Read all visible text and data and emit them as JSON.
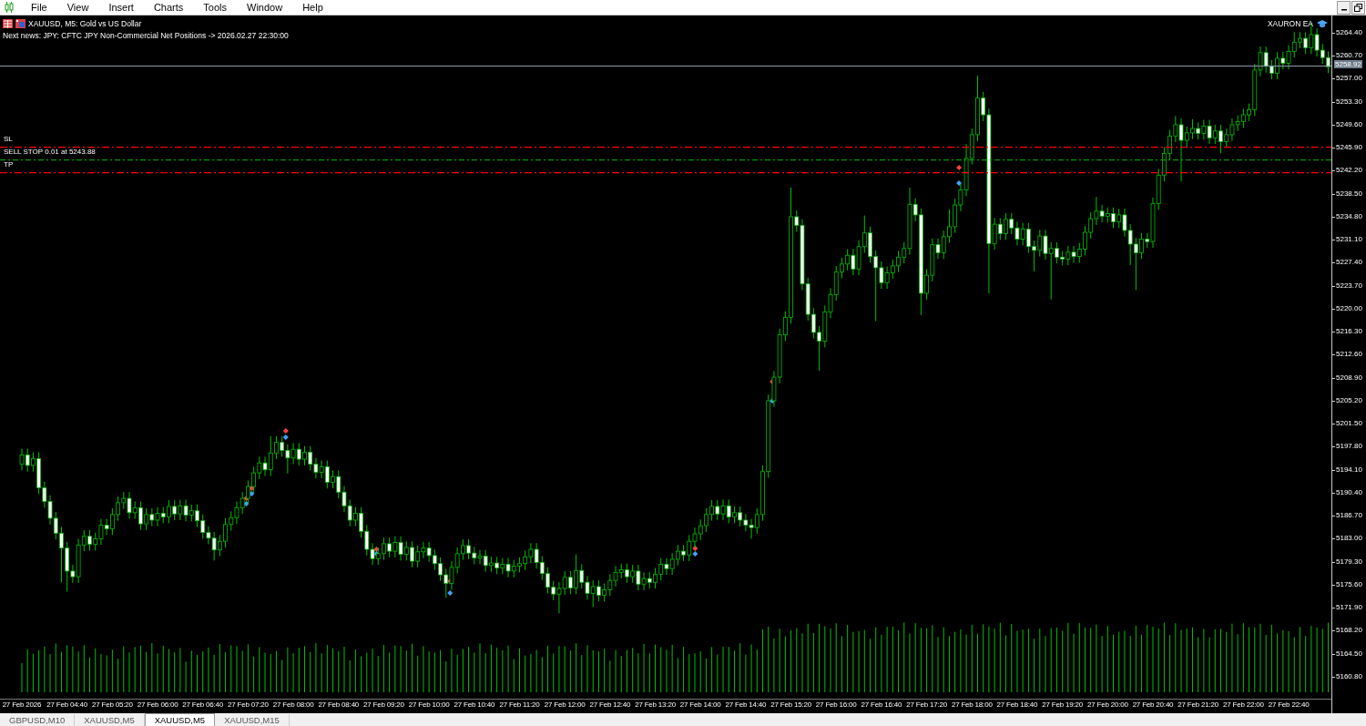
{
  "menu": [
    {
      "label": "File"
    },
    {
      "label": "View"
    },
    {
      "label": "Insert"
    },
    {
      "label": "Charts"
    },
    {
      "label": "Tools"
    },
    {
      "label": "Window"
    },
    {
      "label": "Help"
    }
  ],
  "chart": {
    "title": "XAUUSD, M5:  Gold vs US Dollar",
    "news": "Next news: JPY: CFTC JPY Non-Commercial Net Positions -> 2026.02.27 22:30:00",
    "expert": "XAURON EA",
    "orders": [
      {
        "kind": "stop_loss",
        "label": "SL",
        "color": "#ff0000"
      },
      {
        "kind": "pending",
        "label": "SELL STOP 0.01 at 5243.88",
        "color": "#00a000"
      },
      {
        "kind": "take_profit",
        "label": "TP",
        "color": "#ff0000"
      }
    ],
    "bid": "5258.92",
    "chart_data": {
      "type": "candlestick",
      "categories": [
        "27 Feb 2026",
        null,
        null,
        null,
        null,
        null,
        null,
        null,
        "27 Feb 04:40",
        null,
        null,
        null,
        null,
        null,
        null,
        null,
        "27 Feb 05:20",
        null,
        null,
        null,
        null,
        null,
        null,
        null,
        "27 Feb 06:00",
        null,
        null,
        null,
        null,
        null,
        null,
        null,
        "27 Feb 06:40",
        null,
        null,
        null,
        null,
        null,
        null,
        null,
        "27 Feb 07:20",
        null,
        null,
        null,
        null,
        null,
        null,
        null,
        "27 Feb 08:00",
        null,
        null,
        null,
        null,
        null,
        null,
        null,
        "27 Feb 08:40",
        null,
        null,
        null,
        null,
        null,
        null,
        null,
        "27 Feb 09:20",
        null,
        null,
        null,
        null,
        null,
        null,
        null,
        "27 Feb 10:00",
        null,
        null,
        null,
        null,
        null,
        null,
        null,
        "27 Feb 10:40",
        null,
        null,
        null,
        null,
        null,
        null,
        null,
        "27 Feb 11:20",
        null,
        null,
        null,
        null,
        null,
        null,
        null,
        "27 Feb 12:00",
        null,
        null,
        null,
        null,
        null,
        null,
        null,
        "27 Feb 12:40",
        null,
        null,
        null,
        null,
        null,
        null,
        null,
        "27 Feb 13:20",
        null,
        null,
        null,
        null,
        null,
        null,
        null,
        "27 Feb 14:00",
        null,
        null,
        null,
        null,
        null,
        null,
        null,
        "27 Feb 14:40",
        null,
        null,
        null,
        null,
        null,
        null,
        null,
        "27 Feb 15:20",
        null,
        null,
        null,
        null,
        null,
        null,
        null,
        "27 Feb 16:00",
        null,
        null,
        null,
        null,
        null,
        null,
        null,
        "27 Feb 16:40",
        null,
        null,
        null,
        null,
        null,
        null,
        null,
        "27 Feb 17:20",
        null,
        null,
        null,
        null,
        null,
        null,
        null,
        "27 Feb 18:00",
        null,
        null,
        null,
        null,
        null,
        null,
        null,
        "27 Feb 18:40",
        null,
        null,
        null,
        null,
        null,
        null,
        null,
        "27 Feb 19:20",
        null,
        null,
        null,
        null,
        null,
        null,
        null,
        "27 Feb 20:00",
        null,
        null,
        null,
        null,
        null,
        null,
        null,
        "27 Feb 20:40",
        null,
        null,
        null,
        null,
        null,
        null,
        null,
        "27 Feb 21:20",
        null,
        null,
        null,
        null,
        null,
        null,
        null,
        "27 Feb 22:00",
        null,
        null,
        null,
        null,
        null,
        null,
        null,
        "27 Feb 22:40",
        null,
        null,
        null,
        null,
        null,
        null,
        null
      ],
      "ohlc": [
        [
          5195.0,
          5197.5,
          5194.0,
          5196.5
        ],
        [
          5196.5,
          5197.5,
          5193.8,
          5194.8
        ],
        [
          5194.8,
          5196.9,
          5193.8,
          5195.9
        ],
        [
          5195.9,
          5196.9,
          5190.2,
          5191.2
        ],
        [
          5191.2,
          5192.2,
          5188.0,
          5189.0
        ],
        [
          5189.0,
          5190.0,
          5185.3,
          5186.3
        ],
        [
          5186.3,
          5187.3,
          5182.9,
          5183.9
        ],
        [
          5183.9,
          5184.9,
          5176.0,
          5181.5
        ],
        [
          5181.5,
          5182.5,
          5174.5,
          5177.8
        ],
        [
          5177.8,
          5178.8,
          5175.9,
          5176.9
        ],
        [
          5176.9,
          5183.0,
          5175.9,
          5182.0
        ],
        [
          5182.0,
          5184.4,
          5181.0,
          5183.4
        ],
        [
          5183.4,
          5184.4,
          5181.1,
          5182.1
        ],
        [
          5182.1,
          5184.0,
          5181.1,
          5183.0
        ],
        [
          5183.0,
          5186.2,
          5182.0,
          5185.2
        ],
        [
          5185.2,
          5186.2,
          5183.6,
          5184.6
        ],
        [
          5184.6,
          5187.9,
          5183.6,
          5186.9
        ],
        [
          5186.9,
          5189.8,
          5185.9,
          5188.8
        ],
        [
          5188.8,
          5190.5,
          5187.8,
          5189.5
        ],
        [
          5189.5,
          5190.5,
          5186.2,
          5187.2
        ],
        [
          5187.2,
          5189.0,
          5186.2,
          5188.0
        ],
        [
          5188.0,
          5189.0,
          5184.4,
          5185.4
        ],
        [
          5185.4,
          5187.9,
          5184.4,
          5186.9
        ],
        [
          5186.9,
          5187.9,
          5185.0,
          5186.0
        ],
        [
          5186.0,
          5188.1,
          5185.0,
          5187.1
        ],
        [
          5187.1,
          5188.1,
          5185.5,
          5186.5
        ],
        [
          5186.5,
          5189.2,
          5185.5,
          5188.2
        ],
        [
          5188.2,
          5189.2,
          5186.0,
          5187.0
        ],
        [
          5187.0,
          5189.3,
          5186.0,
          5188.3
        ],
        [
          5188.3,
          5189.3,
          5185.8,
          5186.8
        ],
        [
          5186.8,
          5188.5,
          5185.8,
          5187.5
        ],
        [
          5187.5,
          5188.5,
          5184.9,
          5185.9
        ],
        [
          5185.9,
          5186.9,
          5183.0,
          5184.0
        ],
        [
          5184.0,
          5185.0,
          5182.1,
          5183.1
        ],
        [
          5183.1,
          5184.1,
          5179.5,
          5181.2
        ],
        [
          5181.2,
          5183.6,
          5180.2,
          5182.6
        ],
        [
          5182.6,
          5186.3,
          5181.6,
          5185.3
        ],
        [
          5185.3,
          5187.4,
          5184.3,
          5186.4
        ],
        [
          5186.4,
          5189.0,
          5185.4,
          5188.0
        ],
        [
          5188.0,
          5190.5,
          5187.0,
          5189.5
        ],
        [
          5189.5,
          5192.4,
          5188.5,
          5191.4
        ],
        [
          5191.4,
          5194.6,
          5190.4,
          5193.6
        ],
        [
          5193.6,
          5196.2,
          5192.6,
          5195.2
        ],
        [
          5195.2,
          5196.2,
          5193.1,
          5194.1
        ],
        [
          5194.1,
          5199.5,
          5193.1,
          5196.8
        ],
        [
          5196.8,
          5199.5,
          5195.8,
          5198.5
        ],
        [
          5198.5,
          5199.5,
          5196.2,
          5197.2
        ],
        [
          5197.2,
          5198.2,
          5193.5,
          5196.0
        ],
        [
          5196.0,
          5198.4,
          5195.0,
          5197.4
        ],
        [
          5197.4,
          5198.4,
          5194.8,
          5195.8
        ],
        [
          5195.8,
          5197.9,
          5194.8,
          5196.9
        ],
        [
          5196.9,
          5197.9,
          5194.0,
          5195.0
        ],
        [
          5195.0,
          5196.0,
          5192.7,
          5193.7
        ],
        [
          5193.7,
          5195.6,
          5192.7,
          5194.6
        ],
        [
          5194.6,
          5195.6,
          5191.1,
          5192.1
        ],
        [
          5192.1,
          5194.0,
          5191.1,
          5193.0
        ],
        [
          5193.0,
          5194.0,
          5189.5,
          5190.5
        ],
        [
          5190.5,
          5191.5,
          5187.3,
          5188.3
        ],
        [
          5188.3,
          5189.3,
          5185.0,
          5186.0
        ],
        [
          5186.0,
          5188.1,
          5185.0,
          5187.1
        ],
        [
          5187.1,
          5188.1,
          5183.2,
          5184.2
        ],
        [
          5184.2,
          5185.2,
          5180.3,
          5181.3
        ],
        [
          5181.3,
          5182.3,
          5178.8,
          5179.8
        ],
        [
          5179.8,
          5181.6,
          5178.8,
          5180.6
        ],
        [
          5180.6,
          5183.2,
          5179.6,
          5182.2
        ],
        [
          5182.2,
          5183.2,
          5180.0,
          5181.0
        ],
        [
          5181.0,
          5183.4,
          5180.0,
          5182.4
        ],
        [
          5182.4,
          5183.4,
          5179.5,
          5180.5
        ],
        [
          5180.5,
          5182.6,
          5179.5,
          5181.6
        ],
        [
          5181.6,
          5182.6,
          5178.4,
          5179.4
        ],
        [
          5179.4,
          5181.9,
          5178.4,
          5180.9
        ],
        [
          5180.9,
          5182.5,
          5179.9,
          5181.5
        ],
        [
          5181.5,
          5182.5,
          5179.3,
          5180.3
        ],
        [
          5180.3,
          5181.3,
          5178.0,
          5179.0
        ],
        [
          5179.0,
          5180.0,
          5176.2,
          5177.2
        ],
        [
          5177.2,
          5178.2,
          5173.5,
          5175.8
        ],
        [
          5175.8,
          5179.4,
          5174.8,
          5178.4
        ],
        [
          5178.4,
          5181.6,
          5177.4,
          5180.6
        ],
        [
          5180.6,
          5182.9,
          5179.6,
          5181.9
        ],
        [
          5181.9,
          5182.9,
          5179.7,
          5180.7
        ],
        [
          5180.7,
          5181.7,
          5178.9,
          5179.9
        ],
        [
          5179.9,
          5181.2,
          5178.9,
          5180.2
        ],
        [
          5180.2,
          5181.2,
          5177.7,
          5178.7
        ],
        [
          5178.7,
          5180.1,
          5177.7,
          5179.1
        ],
        [
          5179.1,
          5180.1,
          5177.3,
          5178.3
        ],
        [
          5178.3,
          5179.9,
          5177.3,
          5178.9
        ],
        [
          5178.9,
          5179.9,
          5176.8,
          5177.8
        ],
        [
          5177.8,
          5179.6,
          5176.8,
          5178.6
        ],
        [
          5178.6,
          5180.0,
          5177.6,
          5179.0
        ],
        [
          5179.0,
          5181.1,
          5178.0,
          5180.1
        ],
        [
          5180.1,
          5182.3,
          5179.1,
          5181.3
        ],
        [
          5181.3,
          5182.3,
          5178.2,
          5179.2
        ],
        [
          5179.2,
          5180.2,
          5176.4,
          5177.4
        ],
        [
          5177.4,
          5178.4,
          5174.2,
          5175.2
        ],
        [
          5175.2,
          5176.2,
          5173.1,
          5174.1
        ],
        [
          5174.1,
          5176.0,
          5171.0,
          5175.0
        ],
        [
          5175.0,
          5177.8,
          5174.0,
          5176.8
        ],
        [
          5176.8,
          5177.8,
          5174.1,
          5175.1
        ],
        [
          5175.1,
          5180.5,
          5174.1,
          5177.9
        ],
        [
          5177.9,
          5178.9,
          5175.0,
          5176.0
        ],
        [
          5176.0,
          5177.0,
          5173.2,
          5174.2
        ],
        [
          5174.2,
          5176.3,
          5172.0,
          5175.3
        ],
        [
          5175.3,
          5176.3,
          5172.9,
          5173.9
        ],
        [
          5173.9,
          5175.8,
          5172.9,
          5174.8
        ],
        [
          5174.8,
          5177.3,
          5173.8,
          5176.3
        ],
        [
          5176.3,
          5178.6,
          5175.3,
          5177.6
        ],
        [
          5177.6,
          5179.0,
          5176.6,
          5178.0
        ],
        [
          5178.0,
          5179.0,
          5175.9,
          5176.9
        ],
        [
          5176.9,
          5178.8,
          5175.9,
          5177.8
        ],
        [
          5177.8,
          5178.8,
          5174.7,
          5175.7
        ],
        [
          5175.7,
          5177.6,
          5174.7,
          5176.6
        ],
        [
          5176.6,
          5177.6,
          5175.0,
          5176.0
        ],
        [
          5176.0,
          5178.3,
          5175.0,
          5177.3
        ],
        [
          5177.3,
          5179.9,
          5176.3,
          5178.9
        ],
        [
          5178.9,
          5179.9,
          5177.2,
          5178.2
        ],
        [
          5178.2,
          5180.7,
          5177.2,
          5179.7
        ],
        [
          5179.7,
          5182.0,
          5178.7,
          5181.0
        ],
        [
          5181.0,
          5182.0,
          5179.4,
          5180.4
        ],
        [
          5180.4,
          5183.6,
          5179.4,
          5182.6
        ],
        [
          5182.6,
          5184.8,
          5181.6,
          5183.8
        ],
        [
          5183.8,
          5186.1,
          5182.8,
          5185.1
        ],
        [
          5185.1,
          5187.9,
          5184.1,
          5186.9
        ],
        [
          5186.9,
          5189.2,
          5185.9,
          5188.2
        ],
        [
          5188.2,
          5189.2,
          5186.0,
          5187.0
        ],
        [
          5187.0,
          5189.3,
          5186.0,
          5188.3
        ],
        [
          5188.3,
          5189.3,
          5185.5,
          5186.5
        ],
        [
          5186.5,
          5188.2,
          5185.5,
          5187.2
        ],
        [
          5187.2,
          5188.2,
          5185.0,
          5186.0
        ],
        [
          5186.0,
          5187.0,
          5184.2,
          5185.2
        ],
        [
          5185.2,
          5186.2,
          5183.0,
          5184.8
        ],
        [
          5184.8,
          5187.9,
          5183.8,
          5186.9
        ],
        [
          5186.9,
          5194.8,
          5185.9,
          5193.8
        ],
        [
          5193.8,
          5206.2,
          5192.8,
          5205.2
        ],
        [
          5205.2,
          5210.0,
          5204.2,
          5209.0
        ],
        [
          5209.0,
          5216.8,
          5208.0,
          5215.8
        ],
        [
          5215.8,
          5219.6,
          5214.8,
          5218.6
        ],
        [
          5218.6,
          5239.5,
          5217.6,
          5234.8
        ],
        [
          5234.8,
          5235.8,
          5232.4,
          5233.4
        ],
        [
          5233.4,
          5234.4,
          5223.0,
          5224.0
        ],
        [
          5224.0,
          5225.0,
          5218.1,
          5219.1
        ],
        [
          5219.1,
          5220.1,
          5215.2,
          5216.2
        ],
        [
          5216.2,
          5217.2,
          5210.0,
          5214.8
        ],
        [
          5214.8,
          5220.5,
          5213.8,
          5219.5
        ],
        [
          5219.5,
          5223.3,
          5218.5,
          5222.3
        ],
        [
          5222.3,
          5226.9,
          5221.3,
          5225.9
        ],
        [
          5225.9,
          5228.2,
          5224.9,
          5227.2
        ],
        [
          5227.2,
          5229.6,
          5226.2,
          5228.6
        ],
        [
          5228.6,
          5229.6,
          5225.4,
          5226.4
        ],
        [
          5226.4,
          5231.0,
          5225.4,
          5230.0
        ],
        [
          5230.0,
          5235.0,
          5229.0,
          5232.2
        ],
        [
          5232.2,
          5233.2,
          5227.4,
          5228.4
        ],
        [
          5228.4,
          5229.4,
          5218.0,
          5226.6
        ],
        [
          5226.6,
          5227.6,
          5223.2,
          5224.2
        ],
        [
          5224.2,
          5226.8,
          5223.2,
          5225.8
        ],
        [
          5225.8,
          5227.9,
          5224.8,
          5226.9
        ],
        [
          5226.9,
          5229.3,
          5225.9,
          5228.3
        ],
        [
          5228.3,
          5230.7,
          5227.3,
          5229.7
        ],
        [
          5229.7,
          5239.5,
          5228.7,
          5236.8
        ],
        [
          5236.8,
          5237.8,
          5234.1,
          5235.1
        ],
        [
          5235.1,
          5236.1,
          5219.0,
          5222.5
        ],
        [
          5222.5,
          5226.4,
          5221.5,
          5225.4
        ],
        [
          5225.4,
          5231.3,
          5224.4,
          5230.3
        ],
        [
          5230.3,
          5231.3,
          5228.0,
          5229.0
        ],
        [
          5229.0,
          5232.6,
          5228.0,
          5231.6
        ],
        [
          5231.6,
          5236.0,
          5230.6,
          5233.2
        ],
        [
          5233.2,
          5237.7,
          5232.2,
          5236.7
        ],
        [
          5236.7,
          5240.1,
          5235.7,
          5239.1
        ],
        [
          5239.1,
          5246.5,
          5238.1,
          5244.2
        ],
        [
          5244.2,
          5249.0,
          5243.2,
          5248.0
        ],
        [
          5248.0,
          5257.5,
          5247.0,
          5253.9
        ],
        [
          5253.9,
          5254.9,
          5250.2,
          5251.2
        ],
        [
          5251.2,
          5252.2,
          5222.5,
          5230.5
        ],
        [
          5230.5,
          5234.6,
          5229.5,
          5233.6
        ],
        [
          5233.6,
          5234.6,
          5231.1,
          5232.1
        ],
        [
          5232.1,
          5235.4,
          5231.1,
          5234.4
        ],
        [
          5234.4,
          5235.4,
          5232.0,
          5233.0
        ],
        [
          5233.0,
          5234.0,
          5230.2,
          5231.2
        ],
        [
          5231.2,
          5233.8,
          5230.2,
          5232.8
        ],
        [
          5232.8,
          5233.8,
          5229.0,
          5230.0
        ],
        [
          5230.0,
          5231.0,
          5226.0,
          5229.4
        ],
        [
          5229.4,
          5232.7,
          5228.4,
          5231.7
        ],
        [
          5231.7,
          5232.7,
          5227.9,
          5228.9
        ],
        [
          5228.9,
          5230.7,
          5221.5,
          5229.7
        ],
        [
          5229.7,
          5230.7,
          5227.3,
          5228.3
        ],
        [
          5228.3,
          5229.3,
          5227.0,
          5228.0
        ],
        [
          5228.0,
          5230.1,
          5227.0,
          5229.1
        ],
        [
          5229.1,
          5230.1,
          5227.4,
          5228.4
        ],
        [
          5228.4,
          5230.6,
          5227.4,
          5229.6
        ],
        [
          5229.6,
          5233.3,
          5228.6,
          5232.3
        ],
        [
          5232.3,
          5235.5,
          5231.3,
          5234.5
        ],
        [
          5234.5,
          5238.0,
          5233.5,
          5235.7
        ],
        [
          5235.7,
          5236.7,
          5233.9,
          5234.9
        ],
        [
          5234.9,
          5236.3,
          5233.9,
          5235.3
        ],
        [
          5235.3,
          5236.3,
          5233.0,
          5234.0
        ],
        [
          5234.0,
          5236.1,
          5233.0,
          5235.1
        ],
        [
          5235.1,
          5236.1,
          5231.6,
          5232.6
        ],
        [
          5232.6,
          5233.6,
          5227.0,
          5230.4
        ],
        [
          5230.4,
          5231.4,
          5223.0,
          5229.0
        ],
        [
          5229.0,
          5232.2,
          5228.0,
          5231.2
        ],
        [
          5231.2,
          5232.2,
          5229.8,
          5230.8
        ],
        [
          5230.8,
          5237.9,
          5229.8,
          5236.9
        ],
        [
          5236.9,
          5242.5,
          5235.9,
          5241.5
        ],
        [
          5241.5,
          5246.0,
          5240.5,
          5245.0
        ],
        [
          5245.0,
          5248.8,
          5244.0,
          5247.8
        ],
        [
          5247.8,
          5251.0,
          5246.8,
          5249.6
        ],
        [
          5249.6,
          5250.6,
          5240.5,
          5247.1
        ],
        [
          5247.1,
          5249.3,
          5246.1,
          5248.3
        ],
        [
          5248.3,
          5250.5,
          5247.3,
          5249.0
        ],
        [
          5249.0,
          5250.0,
          5247.2,
          5248.2
        ],
        [
          5248.2,
          5250.4,
          5247.2,
          5249.4
        ],
        [
          5249.4,
          5250.4,
          5246.5,
          5247.5
        ],
        [
          5247.5,
          5249.6,
          5246.5,
          5248.6
        ],
        [
          5248.6,
          5249.6,
          5245.0,
          5246.9
        ],
        [
          5246.9,
          5249.0,
          5245.9,
          5248.0
        ],
        [
          5248.0,
          5250.6,
          5247.0,
          5249.6
        ],
        [
          5249.6,
          5251.1,
          5248.6,
          5250.1
        ],
        [
          5250.1,
          5252.2,
          5249.1,
          5251.2
        ],
        [
          5251.2,
          5253.0,
          5250.2,
          5252.0
        ],
        [
          5252.0,
          5259.4,
          5251.0,
          5258.4
        ],
        [
          5258.4,
          5262.2,
          5257.4,
          5261.2
        ],
        [
          5261.2,
          5262.2,
          5258.0,
          5259.0
        ],
        [
          5259.0,
          5260.0,
          5256.9,
          5257.9
        ],
        [
          5257.9,
          5261.3,
          5256.9,
          5260.3
        ],
        [
          5260.3,
          5261.3,
          5258.5,
          5259.5
        ],
        [
          5259.5,
          5262.4,
          5258.5,
          5261.4
        ],
        [
          5261.4,
          5264.5,
          5260.4,
          5262.9
        ],
        [
          5262.9,
          5264.5,
          5261.9,
          5263.5
        ],
        [
          5263.5,
          5264.5,
          5261.0,
          5262.0
        ],
        [
          5262.0,
          5266.0,
          5261.0,
          5264.1
        ],
        [
          5264.1,
          5265.1,
          5260.6,
          5261.6
        ],
        [
          5261.6,
          5262.6,
          5259.4,
          5260.4
        ],
        [
          5260.4,
          5261.4,
          5257.9,
          5258.9
        ]
      ],
      "ylim": [
        5154.93,
        5267.18
      ],
      "yticks": [
        {
          "value": 5264.4,
          "label": "5264.40"
        },
        {
          "value": 5260.7,
          "label": "5260.70"
        },
        {
          "value": 5257.0,
          "label": "5257.00"
        },
        {
          "value": 5253.3,
          "label": "5253.30"
        },
        {
          "value": 5249.6,
          "label": "5249.60"
        },
        {
          "value": 5245.9,
          "label": "5245.90"
        },
        {
          "value": 5242.2,
          "label": "5242.20"
        },
        {
          "value": 5238.5,
          "label": "5238.50"
        },
        {
          "value": 5234.8,
          "label": "5234.80"
        },
        {
          "value": 5231.1,
          "label": "5231.10"
        },
        {
          "value": 5227.4,
          "label": "5227.40"
        },
        {
          "value": 5223.7,
          "label": "5223.70"
        },
        {
          "value": 5220.0,
          "label": "5220.00"
        },
        {
          "value": 5216.3,
          "label": "5216.30"
        },
        {
          "value": 5212.6,
          "label": "5212.60"
        },
        {
          "value": 5208.9,
          "label": "5208.90"
        },
        {
          "value": 5205.2,
          "label": "5205.20"
        },
        {
          "value": 5201.5,
          "label": "5201.50"
        },
        {
          "value": 5197.8,
          "label": "5197.80"
        },
        {
          "value": 5194.1,
          "label": "5194.10"
        },
        {
          "value": 5190.4,
          "label": "5190.40"
        },
        {
          "value": 5186.7,
          "label": "5186.70"
        },
        {
          "value": 5183.0,
          "label": "5183.00"
        },
        {
          "value": 5179.3,
          "label": "5179.30"
        },
        {
          "value": 5175.6,
          "label": "5175.60"
        },
        {
          "value": 5171.9,
          "label": "5171.90"
        },
        {
          "value": 5168.2,
          "label": "5168.20"
        },
        {
          "value": 5164.5,
          "label": "5164.50"
        },
        {
          "value": 5160.8,
          "label": "5160.80"
        }
      ]
    }
  },
  "tabs": [
    {
      "label": "GBPUSD,M10",
      "selected": false
    },
    {
      "label": "XAUUSD,M5",
      "selected": false
    },
    {
      "label": "XAUUSD,M5",
      "selected": true
    },
    {
      "label": "XAUUSD,M15",
      "selected": false
    }
  ]
}
